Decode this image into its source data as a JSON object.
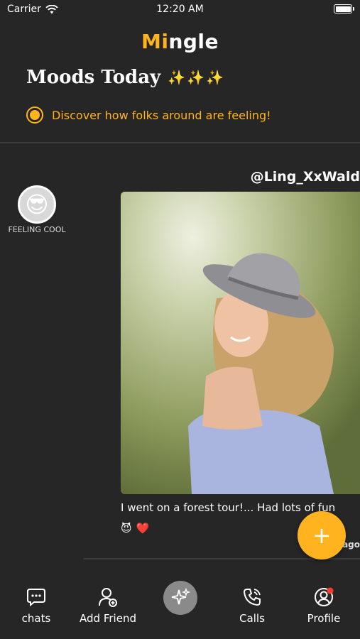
{
  "status": {
    "carrier": "Carrier",
    "time": "12:20 AM"
  },
  "app": {
    "name_prefix": "Mi",
    "name_suffix": "ngle",
    "accent": "#FFB41F"
  },
  "header": {
    "moods_title": "Moods Today",
    "sparkles": "✨✨✨",
    "discover_text": "Discover how folks around are feeling!"
  },
  "mood": {
    "emoji": "😎",
    "label": "FEELING COOL"
  },
  "post": {
    "username": "@Ling_XxWald",
    "caption": "I went on a forest tour!... Had lots of fun",
    "reactions": [
      "😈",
      "❤️"
    ],
    "time_ago": "ago"
  },
  "fab": {
    "icon": "+"
  },
  "tabs": [
    {
      "label": "chats",
      "icon": "chat-icon"
    },
    {
      "label": "Add Friend",
      "icon": "add-friend-icon"
    },
    {
      "label": "",
      "icon": "sparkles-icon"
    },
    {
      "label": "Calls",
      "icon": "phone-icon"
    },
    {
      "label": "Profile",
      "icon": "profile-icon"
    }
  ]
}
